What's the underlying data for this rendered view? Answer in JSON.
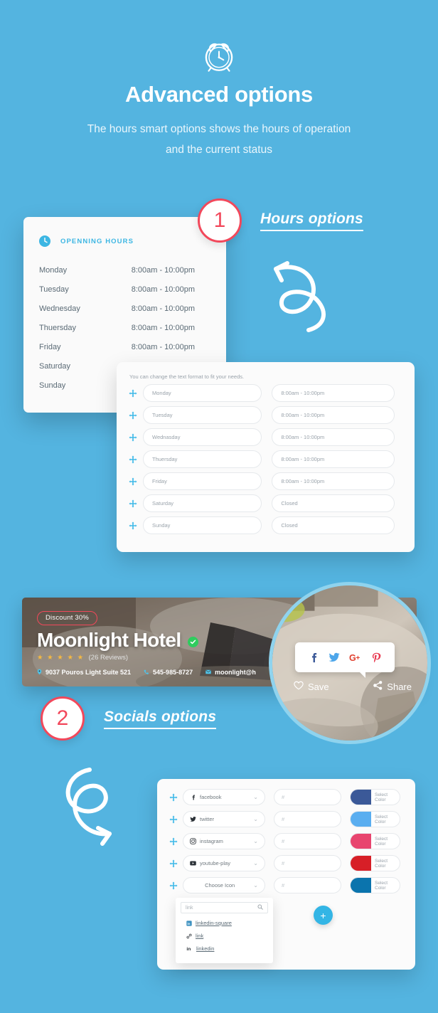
{
  "theme": {
    "background": "#54b4e0",
    "accent": "#33b5e5",
    "badge_red": "#f2485b"
  },
  "hero": {
    "icon": "alarm-clock-icon",
    "title": "Advanced options",
    "subtitle": "The hours smart options shows the hours of operation and the current status"
  },
  "steps": [
    {
      "number": "1",
      "label": "Hours options"
    },
    {
      "number": "2",
      "label": "Socials options"
    }
  ],
  "hours_card": {
    "header_icon": "clock-icon",
    "header_title": "OPENNING HOURS",
    "rows": [
      {
        "day": "Monday",
        "time": "8:00am - 10:00pm"
      },
      {
        "day": "Tuesday",
        "time": "8:00am - 10:00pm"
      },
      {
        "day": "Wednesday",
        "time": "8:00am - 10:00pm"
      },
      {
        "day": "Thuersday",
        "time": "8:00am - 10:00pm"
      },
      {
        "day": "Friday",
        "time": "8:00am - 10:00pm"
      },
      {
        "day": "Saturday",
        "time": ""
      },
      {
        "day": "Sunday",
        "time": ""
      }
    ]
  },
  "hours_form": {
    "note": "You can change the text format to fit your needs.",
    "rows": [
      {
        "day": "Monday",
        "time": "8:00am - 10:00pm"
      },
      {
        "day": "Tuesday",
        "time": "8:00am - 10:00pm"
      },
      {
        "day": "Wednasday",
        "time": "8:00am - 10:00pm"
      },
      {
        "day": "Thuersday",
        "time": "8:00am - 10:00pm"
      },
      {
        "day": "Friday",
        "time": "8:00am - 10:00pm"
      },
      {
        "day": "Saturday",
        "time": "Closed"
      },
      {
        "day": "Sunday",
        "time": "Closed"
      }
    ]
  },
  "hotel_card": {
    "discount": "Discount 30%",
    "name": "Moonlight Hotel",
    "verified_icon": "verified-check-icon",
    "stars": "★ ★ ★ ★ ★",
    "reviews": "(26 Reviews)",
    "address": "9037 Pouros Light Suite 521",
    "phone": "545-985-8727",
    "email": "moonlight@h"
  },
  "magnifier": {
    "share_icons": [
      "facebook-icon",
      "twitter-icon",
      "google-plus-icon",
      "pinterest-icon"
    ],
    "save_label": "Save",
    "share_label": "Share"
  },
  "socials_form": {
    "rows": [
      {
        "icon": "facebook-icon",
        "name": "facebook",
        "link_placeholder": "#",
        "color": "#3b5998",
        "color_label": "Select Color"
      },
      {
        "icon": "twitter-icon",
        "name": "twitter",
        "link_placeholder": "#",
        "color": "#5aaef0",
        "color_label": "Select Color"
      },
      {
        "icon": "instagram-icon",
        "name": "instagram",
        "link_placeholder": "#",
        "color": "#e8456f",
        "color_label": "Select Color"
      },
      {
        "icon": "youtube-play-icon",
        "name": "youtube-play",
        "link_placeholder": "#",
        "color": "#d71f27",
        "color_label": "Select Color"
      },
      {
        "icon": "",
        "name": "Choose Icon",
        "link_placeholder": "#",
        "color": "#0b74ad",
        "color_label": "Select Color"
      }
    ],
    "icon_search": {
      "value": "link",
      "search_icon": "magnifier-icon"
    },
    "icon_results": [
      {
        "glyph": "linkedin-square-icon",
        "label": "linkedin-square"
      },
      {
        "glyph": "link-icon",
        "label": "link"
      },
      {
        "glyph": "linkedin-icon",
        "label": "linkedin"
      }
    ],
    "add_button_label": "+"
  }
}
